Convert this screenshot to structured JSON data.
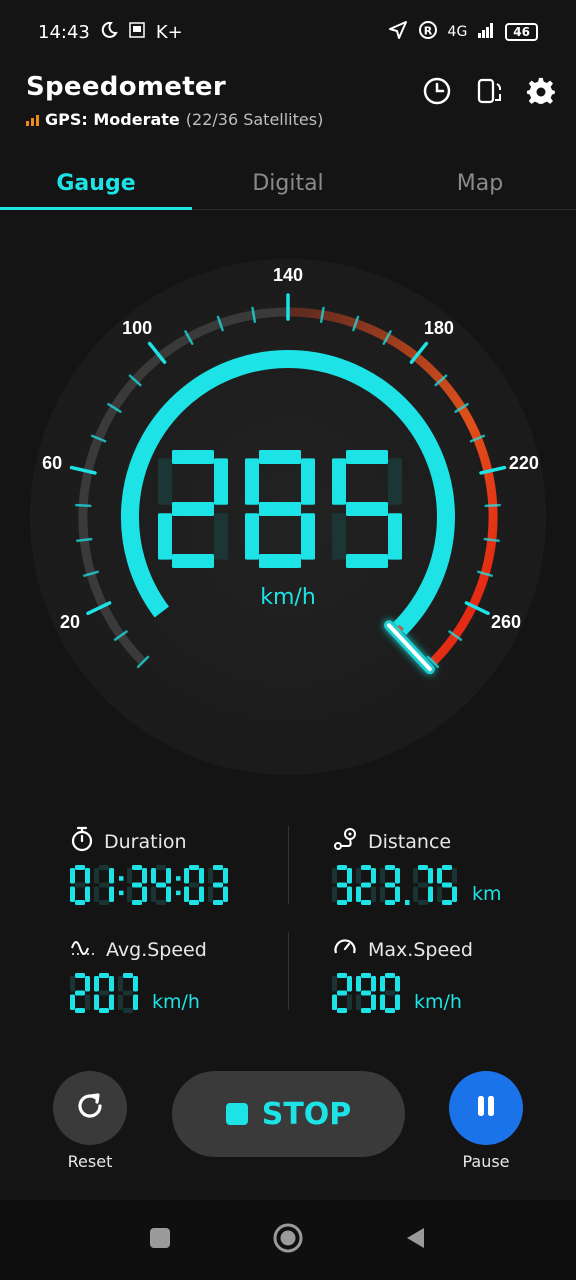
{
  "status_bar": {
    "time": "14:43",
    "left_icons": [
      "moon-icon",
      "sim-icon"
    ],
    "carrier_tag": "K+",
    "network": "4G",
    "battery": "46"
  },
  "header": {
    "title": "Speedometer",
    "gps_label": "GPS: Moderate",
    "gps_satellites": "(22/36 Satellites)",
    "icons": [
      "history-icon",
      "screen-rotate-icon",
      "settings-gear-icon"
    ]
  },
  "tabs": [
    {
      "label": "Gauge",
      "active": true
    },
    {
      "label": "Digital",
      "active": false
    },
    {
      "label": "Map",
      "active": false
    }
  ],
  "gauge": {
    "speed": "285",
    "unit": "km/h",
    "max": 280,
    "labels": [
      "20",
      "60",
      "100",
      "140",
      "180",
      "220",
      "260"
    ],
    "accent_color": "#1de3e6",
    "warning_color": "#e8361a"
  },
  "stats": {
    "duration": {
      "label": "Duration",
      "value": "01:34:03",
      "icon": "stopwatch-icon"
    },
    "distance": {
      "label": "Distance",
      "value": "323.75",
      "unit": "km",
      "icon": "route-pin-icon"
    },
    "avg_speed": {
      "label": "Avg.Speed",
      "value": "207",
      "unit": "km/h",
      "icon": "wave-speed-icon"
    },
    "max_speed": {
      "label": "Max.Speed",
      "value": "290",
      "unit": "km/h",
      "icon": "gauge-icon"
    }
  },
  "controls": {
    "reset_label": "Reset",
    "stop_label": "STOP",
    "pause_label": "Pause"
  },
  "navbar": [
    "recents-square-icon",
    "home-circle-icon",
    "back-triangle-icon"
  ]
}
